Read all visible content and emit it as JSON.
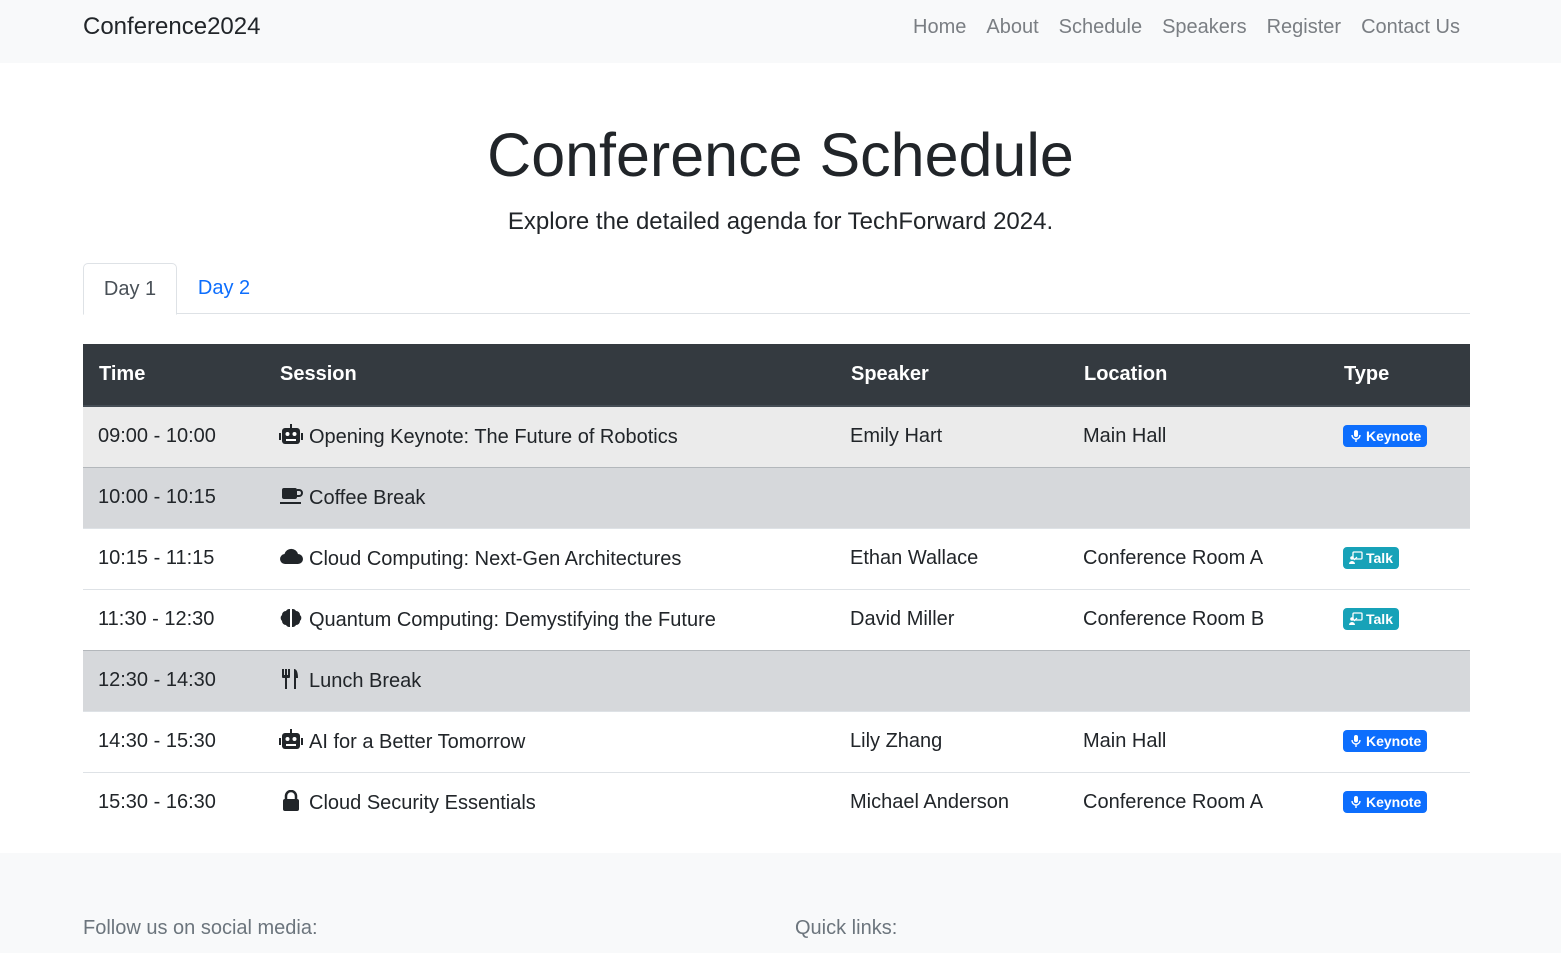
{
  "nav": {
    "brand": "Conference2024",
    "links": [
      "Home",
      "About",
      "Schedule",
      "Speakers",
      "Register",
      "Contact Us"
    ]
  },
  "hero": {
    "title": "Conference Schedule",
    "subtitle": "Explore the detailed agenda for TechForward 2024."
  },
  "tabs": [
    {
      "label": "Day 1",
      "active": true
    },
    {
      "label": "Day 2",
      "active": false
    }
  ],
  "table": {
    "headers": [
      "Time",
      "Session",
      "Speaker",
      "Location",
      "Type"
    ],
    "rows": [
      {
        "time": "09:00 - 10:00",
        "icon": "robot-icon",
        "session": "Opening Keynote: The Future of Robotics",
        "speaker": "Emily Hart",
        "location": "Main Hall",
        "type": "Keynote",
        "kind": "odd"
      },
      {
        "time": "10:00 - 10:15",
        "icon": "coffee-icon",
        "session": "Coffee Break",
        "speaker": "",
        "location": "",
        "type": "",
        "kind": "break"
      },
      {
        "time": "10:15 - 11:15",
        "icon": "cloud-icon",
        "session": "Cloud Computing: Next-Gen Architectures",
        "speaker": "Ethan Wallace",
        "location": "Conference Room A",
        "type": "Talk",
        "kind": "even"
      },
      {
        "time": "11:30 - 12:30",
        "icon": "brain-icon",
        "session": "Quantum Computing: Demystifying the Future",
        "speaker": "David Miller",
        "location": "Conference Room B",
        "type": "Talk",
        "kind": "even"
      },
      {
        "time": "12:30 - 14:30",
        "icon": "utensils-icon",
        "session": "Lunch Break",
        "speaker": "",
        "location": "",
        "type": "",
        "kind": "break"
      },
      {
        "time": "14:30 - 15:30",
        "icon": "robot-icon",
        "session": "AI for a Better Tomorrow",
        "speaker": "Lily Zhang",
        "location": "Main Hall",
        "type": "Keynote",
        "kind": "even"
      },
      {
        "time": "15:30 - 16:30",
        "icon": "lock-icon",
        "session": "Cloud Security Essentials",
        "speaker": "Michael Anderson",
        "location": "Conference Room A",
        "type": "Keynote",
        "kind": "even"
      }
    ]
  },
  "badge_colors": {
    "Keynote": "#0d6efd",
    "Talk": "#17a2b8"
  },
  "footer": {
    "social_label": "Follow us on social media:",
    "links_label": "Quick links:"
  }
}
